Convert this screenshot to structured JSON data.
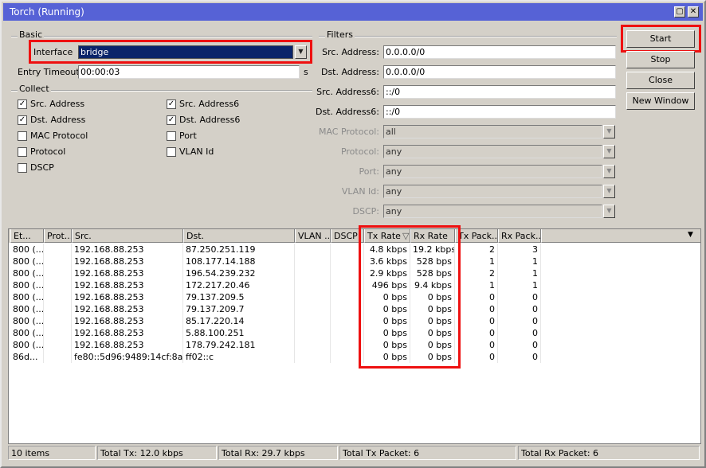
{
  "window": {
    "title": "Torch (Running)",
    "minimize_glyph": "▢",
    "close_glyph": "✕"
  },
  "basic": {
    "group_label": "Basic",
    "interface_label": "Interface",
    "interface_value": "bridge",
    "entry_timeout_label": "Entry Timeout",
    "entry_timeout_value": "00:00:03",
    "entry_timeout_unit": "s"
  },
  "collect": {
    "group_label": "Collect",
    "items": [
      {
        "label": "Src. Address",
        "checked": true
      },
      {
        "label": "Dst. Address",
        "checked": true
      },
      {
        "label": "MAC Protocol",
        "checked": false
      },
      {
        "label": "Protocol",
        "checked": false
      },
      {
        "label": "DSCP",
        "checked": false
      },
      {
        "label": "Src. Address6",
        "checked": true
      },
      {
        "label": "Dst. Address6",
        "checked": true
      },
      {
        "label": "Port",
        "checked": false
      },
      {
        "label": "VLAN Id",
        "checked": false
      }
    ]
  },
  "filters": {
    "group_label": "Filters",
    "fields": [
      {
        "label": "Src. Address:",
        "value": "0.0.0.0/0"
      },
      {
        "label": "Dst. Address:",
        "value": "0.0.0.0/0"
      },
      {
        "label": "Src. Address6:",
        "value": "::/0"
      },
      {
        "label": "Dst. Address6:",
        "value": "::/0"
      }
    ],
    "disabled": [
      {
        "label": "MAC Protocol:",
        "value": "all"
      },
      {
        "label": "Protocol:",
        "value": "any"
      },
      {
        "label": "Port:",
        "value": "any"
      },
      {
        "label": "VLAN Id:",
        "value": "any"
      },
      {
        "label": "DSCP:",
        "value": "any"
      }
    ]
  },
  "buttons": {
    "start": "Start",
    "stop": "Stop",
    "close": "Close",
    "new_window": "New Window"
  },
  "table": {
    "columns": [
      "Et...",
      "Prot...",
      "Src.",
      "Dst.",
      "VLAN ...",
      "DSCP",
      "Tx Rate",
      "Rx Rate",
      "Tx Pack...",
      "Rx Pack..."
    ],
    "sort_indicator": "▽",
    "menu_glyph": "▼",
    "rows": [
      [
        "800 (...",
        "",
        "192.168.88.253",
        "87.250.251.119",
        "",
        "",
        "4.8 kbps",
        "19.2 kbps",
        "2",
        "3"
      ],
      [
        "800 (...",
        "",
        "192.168.88.253",
        "108.177.14.188",
        "",
        "",
        "3.6 kbps",
        "528 bps",
        "1",
        "1"
      ],
      [
        "800 (...",
        "",
        "192.168.88.253",
        "196.54.239.232",
        "",
        "",
        "2.9 kbps",
        "528 bps",
        "2",
        "1"
      ],
      [
        "800 (...",
        "",
        "192.168.88.253",
        "172.217.20.46",
        "",
        "",
        "496 bps",
        "9.4 kbps",
        "1",
        "1"
      ],
      [
        "800 (...",
        "",
        "192.168.88.253",
        "79.137.209.5",
        "",
        "",
        "0 bps",
        "0 bps",
        "0",
        "0"
      ],
      [
        "800 (...",
        "",
        "192.168.88.253",
        "79.137.209.7",
        "",
        "",
        "0 bps",
        "0 bps",
        "0",
        "0"
      ],
      [
        "800 (...",
        "",
        "192.168.88.253",
        "85.17.220.14",
        "",
        "",
        "0 bps",
        "0 bps",
        "0",
        "0"
      ],
      [
        "800 (...",
        "",
        "192.168.88.253",
        "5.88.100.251",
        "",
        "",
        "0 bps",
        "0 bps",
        "0",
        "0"
      ],
      [
        "800 (...",
        "",
        "192.168.88.253",
        "178.79.242.181",
        "",
        "",
        "0 bps",
        "0 bps",
        "0",
        "0"
      ],
      [
        "86d...",
        "",
        "fe80::5d96:9489:14cf:8a...",
        "ff02::c",
        "",
        "",
        "0 bps",
        "0 bps",
        "0",
        "0"
      ]
    ]
  },
  "status": {
    "items": "10 items",
    "total_tx": "Total Tx: 12.0 kbps",
    "total_rx": "Total Rx: 29.7 kbps",
    "total_tx_packet": "Total Tx Packet: 6",
    "total_rx_packet": "Total Rx Packet: 6"
  },
  "colors": {
    "titlebar": "#5662d6",
    "highlight": "#ee1010",
    "selection": "#0a246a"
  }
}
